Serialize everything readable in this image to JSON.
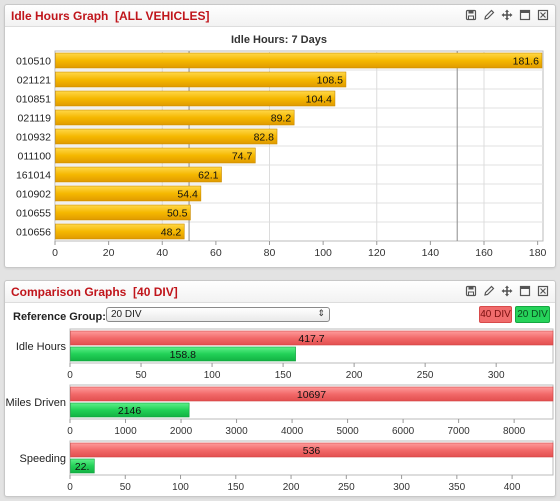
{
  "panel1": {
    "title": "Idle Hours Graph  [ALL VEHICLES]",
    "tools": [
      "save-icon",
      "edit-icon",
      "move-icon",
      "maximize-icon",
      "close-icon"
    ]
  },
  "panel2": {
    "title": "Comparison Graphs  [40 DIV]",
    "reference_label": "Reference Group:",
    "reference_value": "20 DIV",
    "legend": [
      {
        "name": "40 DIV",
        "color": "#f06c6c"
      },
      {
        "name": "20 DIV",
        "color": "#26d35a"
      }
    ]
  },
  "chart_data": [
    {
      "type": "bar",
      "orientation": "horizontal",
      "title": "Idle Hours: 7 Days",
      "categories": [
        "010510",
        "021121",
        "010851",
        "021119",
        "010932",
        "011100",
        "161014",
        "010902",
        "010655",
        "010656"
      ],
      "values": [
        181.6,
        108.5,
        104.4,
        89.2,
        82.8,
        74.7,
        62.1,
        54.4,
        50.5,
        48.2
      ],
      "x_ticks": [
        0,
        20,
        40,
        60,
        80,
        100,
        120,
        140,
        160,
        180
      ],
      "xlim": [
        0,
        182
      ],
      "reference_lines": [
        50,
        150
      ],
      "color": "#f5b800"
    },
    {
      "type": "bar",
      "orientation": "horizontal",
      "category": "Idle Hours",
      "series": [
        {
          "name": "40 DIV",
          "value": 417.7,
          "label": "417.7"
        },
        {
          "name": "20 DIV",
          "value": 158.8,
          "label": "158.8"
        }
      ],
      "x_ticks": [
        0,
        50,
        100,
        150,
        200,
        250,
        300
      ],
      "xlim": [
        0,
        340
      ]
    },
    {
      "type": "bar",
      "orientation": "horizontal",
      "category": "Miles Driven",
      "series": [
        {
          "name": "40 DIV",
          "value": 10697,
          "label": "10697"
        },
        {
          "name": "20 DIV",
          "value": 2146,
          "label": "2146"
        }
      ],
      "x_ticks": [
        0,
        1000,
        2000,
        3000,
        4000,
        5000,
        6000,
        7000,
        8000
      ],
      "xlim": [
        0,
        8700
      ]
    },
    {
      "type": "bar",
      "orientation": "horizontal",
      "category": "Speeding",
      "series": [
        {
          "name": "40 DIV",
          "value": 536,
          "label": "536"
        },
        {
          "name": "20 DIV",
          "value": 22,
          "label": "22."
        }
      ],
      "x_ticks": [
        0,
        50,
        100,
        150,
        200,
        250,
        300,
        350,
        400
      ],
      "xlim": [
        0,
        437
      ]
    }
  ]
}
